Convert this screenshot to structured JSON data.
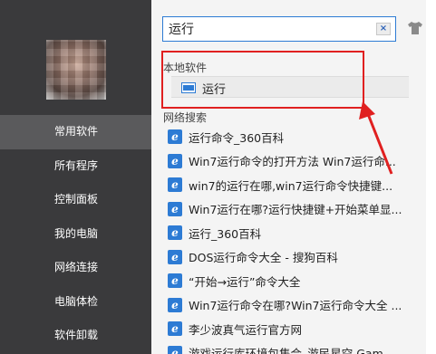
{
  "sidebar": {
    "items": [
      {
        "label": "常用软件"
      },
      {
        "label": "所有程序"
      },
      {
        "label": "控制面板"
      },
      {
        "label": "我的电脑"
      },
      {
        "label": "网络连接"
      },
      {
        "label": "电脑体检"
      },
      {
        "label": "软件卸载"
      }
    ],
    "active_index": 0
  },
  "search": {
    "value": "运行"
  },
  "clear_label": "×",
  "local": {
    "title": "本地软件",
    "item": {
      "label": "运行",
      "icon": "run-app-icon"
    }
  },
  "web": {
    "title": "网络搜索",
    "icon_glyph": "e",
    "results": [
      {
        "label": "运行命令_360百科"
      },
      {
        "label": "Win7运行命令的打开方法 Win7运行命..."
      },
      {
        "label": "win7的运行在哪,win7运行命令快捷键..."
      },
      {
        "label": "Win7运行在哪?运行快捷键+开始菜单显..."
      },
      {
        "label": "运行_360百科"
      },
      {
        "label": "DOS运行命令大全 - 搜狗百科"
      },
      {
        "label": "“开始→运行”命令大全"
      },
      {
        "label": "Win7运行命令在哪?Win7运行命令大全 ..."
      },
      {
        "label": "李少波真气运行官方网"
      },
      {
        "label": "游戏运行库环境包集合_游民星空 Gam..."
      }
    ]
  },
  "colors": {
    "sidebar": "#3a3a3c",
    "accent": "#2d7bd4",
    "highlight": "#e02020"
  }
}
